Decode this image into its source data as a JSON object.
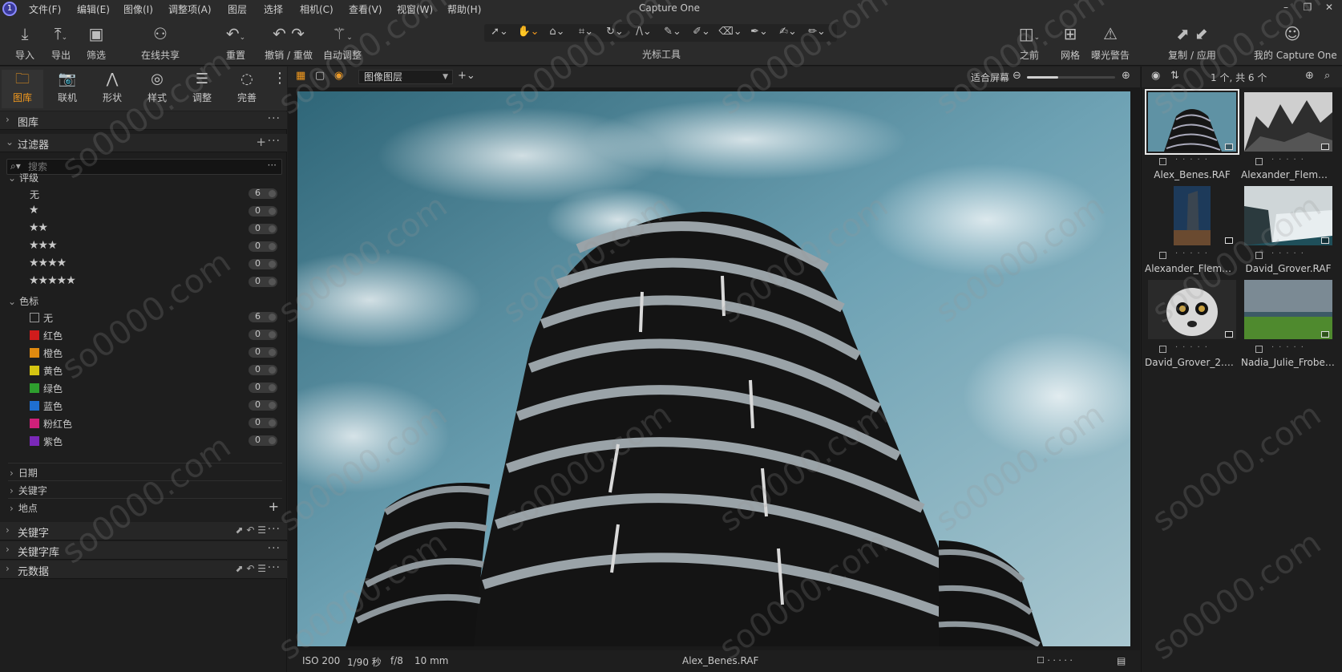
{
  "menu": {
    "items": [
      "文件(F)",
      "编辑(E)",
      "图像(I)",
      "调整项(A)",
      "图层",
      "选择",
      "相机(C)",
      "查看(V)",
      "视窗(W)",
      "帮助(H)"
    ]
  },
  "app_title": "Capture One",
  "window_controls": {
    "minimize": "–",
    "restore": "❐",
    "close": "✕"
  },
  "toolbar": {
    "import": "导入",
    "export": "导出",
    "filter": "筛选",
    "live_share": "在线共享",
    "reset": "重置",
    "undo_redo": "撤销 / 重做",
    "auto_adjust": "自动调整",
    "cursor_tools": "光标工具",
    "before": "之前",
    "grid": "网格",
    "exposure_warning": "曝光警告",
    "copy_apply": "复制 / 应用",
    "my_capture_one": "我的 Capture One"
  },
  "tool_tabs": [
    {
      "label": "图库",
      "icon": "folder-icon"
    },
    {
      "label": "联机",
      "icon": "camera-icon"
    },
    {
      "label": "形状",
      "icon": "compass-icon"
    },
    {
      "label": "样式",
      "icon": "style-icon"
    },
    {
      "label": "调整",
      "icon": "sliders-icon"
    },
    {
      "label": "完善",
      "icon": "refine-icon"
    }
  ],
  "library_panel": {
    "title": "图库"
  },
  "filters_panel": {
    "title": "过滤器",
    "search_placeholder": "搜索",
    "rating_group": "评级",
    "ratings": [
      {
        "label": "无",
        "stars": "",
        "count": "6"
      },
      {
        "label": "",
        "stars": "★",
        "count": "0"
      },
      {
        "label": "",
        "stars": "★★",
        "count": "0"
      },
      {
        "label": "",
        "stars": "★★★",
        "count": "0"
      },
      {
        "label": "",
        "stars": "★★★★",
        "count": "0"
      },
      {
        "label": "",
        "stars": "★★★★★",
        "count": "0"
      }
    ],
    "color_group": "色标",
    "colors": [
      {
        "label": "无",
        "color": "",
        "count": "6"
      },
      {
        "label": "红色",
        "color": "#d01c1c",
        "count": "0"
      },
      {
        "label": "橙色",
        "color": "#e08a10",
        "count": "0"
      },
      {
        "label": "黄色",
        "color": "#d4c412",
        "count": "0"
      },
      {
        "label": "绿色",
        "color": "#2e9e2e",
        "count": "0"
      },
      {
        "label": "蓝色",
        "color": "#1f6fd0",
        "count": "0"
      },
      {
        "label": "粉红色",
        "color": "#d0207a",
        "count": "0"
      },
      {
        "label": "紫色",
        "color": "#7a28b8",
        "count": "0"
      }
    ],
    "date": "日期",
    "keywords": "关键字",
    "location": "地点"
  },
  "keywords_panel": {
    "title": "关键字"
  },
  "keyword_library_panel": {
    "title": "关键字库"
  },
  "metadata_panel": {
    "title": "元数据"
  },
  "viewer": {
    "layer_select": "图像图层",
    "fit": "适合屏幕",
    "zoom_level": 0.35
  },
  "image_info": {
    "iso": "ISO 200",
    "shutter": "1/90 秒",
    "aperture": "f/8",
    "focal": "10 mm",
    "filename": "Alex_Benes.RAF"
  },
  "browser": {
    "count": "1 个, 共 6 个",
    "thumbnails": [
      {
        "name": "Alex_Benes.RAF",
        "selected": true
      },
      {
        "name": "Alexander_Flemmin...",
        "selected": false
      },
      {
        "name": "Alexander_Flemmin...",
        "selected": false
      },
      {
        "name": "David_Grover.RAF",
        "selected": false
      },
      {
        "name": "David_Grover_2.ARW",
        "selected": false
      },
      {
        "name": "Nadia_Julie_Froberg...",
        "selected": false
      }
    ]
  },
  "watermark": "so0000.com",
  "colors": {
    "accent": "#f39a1e",
    "panel_bg": "#1e1e1e",
    "bar_bg": "#2b2b2b"
  }
}
